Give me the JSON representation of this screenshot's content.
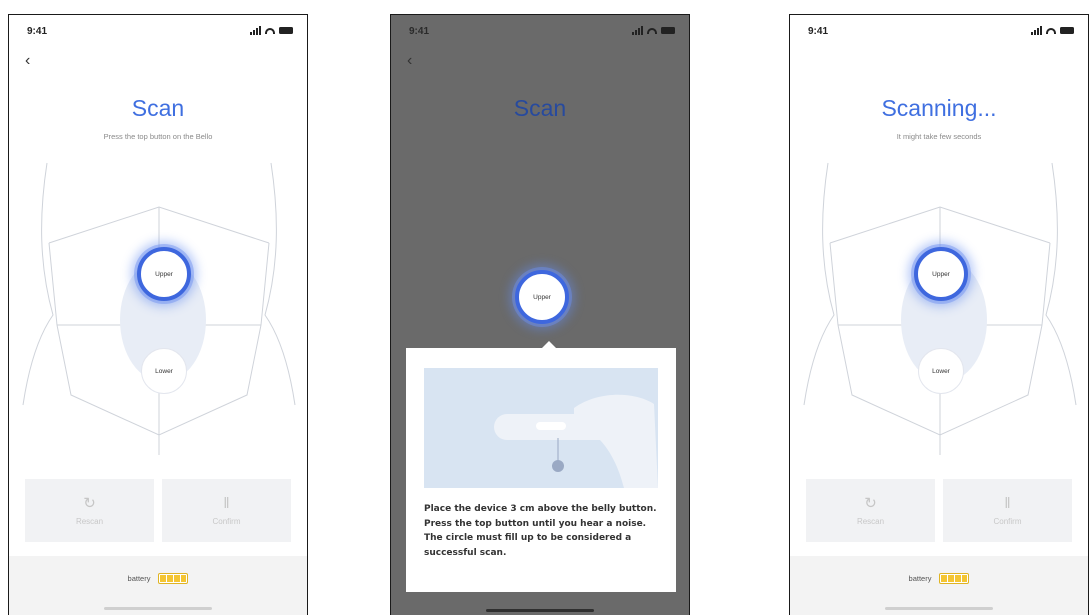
{
  "status": {
    "time": "9:41"
  },
  "screens": [
    {
      "title": "Scan",
      "subtitle": "Press the top button on the Bello",
      "zones": {
        "upper": "Upper",
        "lower": "Lower"
      },
      "actions": {
        "rescan": "Rescan",
        "confirm": "Confirm"
      },
      "battery_label": "battery"
    },
    {
      "title": "Scan",
      "zones": {
        "upper": "Upper"
      },
      "tooltip": "Place the device 3 cm above the belly button. Press the top button until you hear a noise. The circle must fill up to be considered a successful scan."
    },
    {
      "title": "Scanning...",
      "subtitle": "It might take few seconds",
      "zones": {
        "upper": "Upper",
        "lower": "Lower"
      },
      "actions": {
        "rescan": "Rescan",
        "confirm": "Confirm"
      },
      "battery_label": "battery"
    }
  ],
  "colors": {
    "accent": "#3f6fe0",
    "battery": "#f4c533",
    "overlay": "#6a6a6a"
  },
  "icons": {
    "back": "chevron-left-icon",
    "rescan": "refresh-icon",
    "confirm": "soundwave-icon",
    "battery": "battery-icon"
  }
}
